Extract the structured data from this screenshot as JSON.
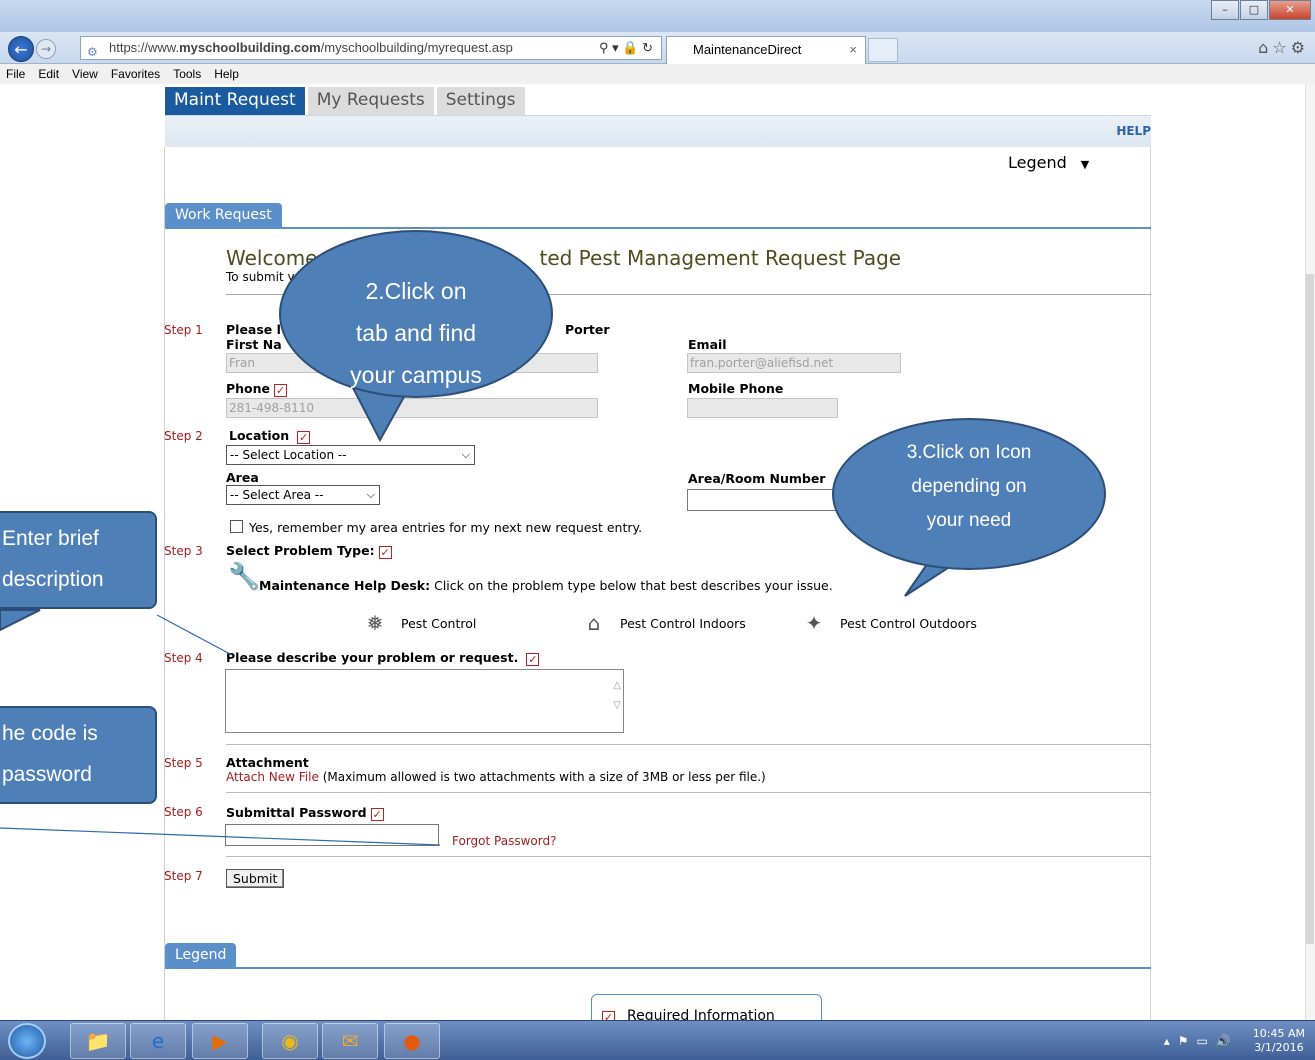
{
  "browser": {
    "url_prefix": "https://www.",
    "url_domain": "myschoolbuilding.com",
    "url_path": "/myschoolbuilding/myrequest.asp",
    "tab_title": "MaintenanceDirect",
    "menu": [
      "File",
      "Edit",
      "View",
      "Favorites",
      "Tools",
      "Help"
    ]
  },
  "app_tabs": [
    "Maint Request",
    "My Requests",
    "Settings"
  ],
  "help_link": "HELP",
  "legend_toggle": "Legend",
  "work_request_tab": "Work Request",
  "welcome": {
    "title": "Welcome",
    "title_tail": "ted Pest Management Request Page",
    "subtitle": "To submit y"
  },
  "steps": {
    "s1": "Step 1",
    "s2": "Step 2",
    "s3": "Step 3",
    "s4": "Step 4",
    "s5": "Step 5",
    "s6": "Step 6",
    "s7": "Step 7"
  },
  "step1": {
    "please_label": "Please l",
    "name_tail": "Porter",
    "first_name_label": "First Na",
    "first_name_value": "Fran",
    "email_label": "Email",
    "email_value": "fran.porter@aliefisd.net",
    "phone_label": "Phone",
    "phone_value": "281-498-8110",
    "mobile_label": "Mobile Phone"
  },
  "step2": {
    "location_label": "Location",
    "location_value": "-- Select Location --",
    "area_label": "Area",
    "area_value": "-- Select Area --",
    "room_label": "Area/Room Number",
    "remember_label": "Yes, remember my area entries for my next new request entry."
  },
  "step3": {
    "label": "Select Problem Type:",
    "helpdesk_bold": "Maintenance Help Desk:",
    "helpdesk_text": "Click on the problem type below that best describes your issue.",
    "types": [
      "Pest Control",
      "Pest Control Indoors",
      "Pest Control Outdoors"
    ]
  },
  "step4": {
    "label": "Please describe your problem or request."
  },
  "step5": {
    "label": "Attachment",
    "link": "Attach New File",
    "note": "(Maximum allowed is two attachments with a size of 3MB or less per file.)"
  },
  "step6": {
    "label": "Submittal Password",
    "forgot": "Forgot Password?"
  },
  "step7": {
    "submit": "Submit"
  },
  "legend_section_tab": "Legend",
  "required_info": "Required Information",
  "callouts": {
    "campus": [
      "2.Click on",
      "tab and find",
      "your campus"
    ],
    "icon": [
      "3.Click on Icon",
      "depending on",
      "your need"
    ],
    "describe": [
      "Enter brief",
      "description"
    ],
    "password": [
      "he code is",
      "password"
    ]
  },
  "taskbar": {
    "time": "10:45 AM",
    "date": "3/1/2016"
  },
  "colors": {
    "accent": "#1a5a9e",
    "section": "#5b8fc9",
    "callout": "#4f7fb7",
    "step": "#a41e1e"
  }
}
